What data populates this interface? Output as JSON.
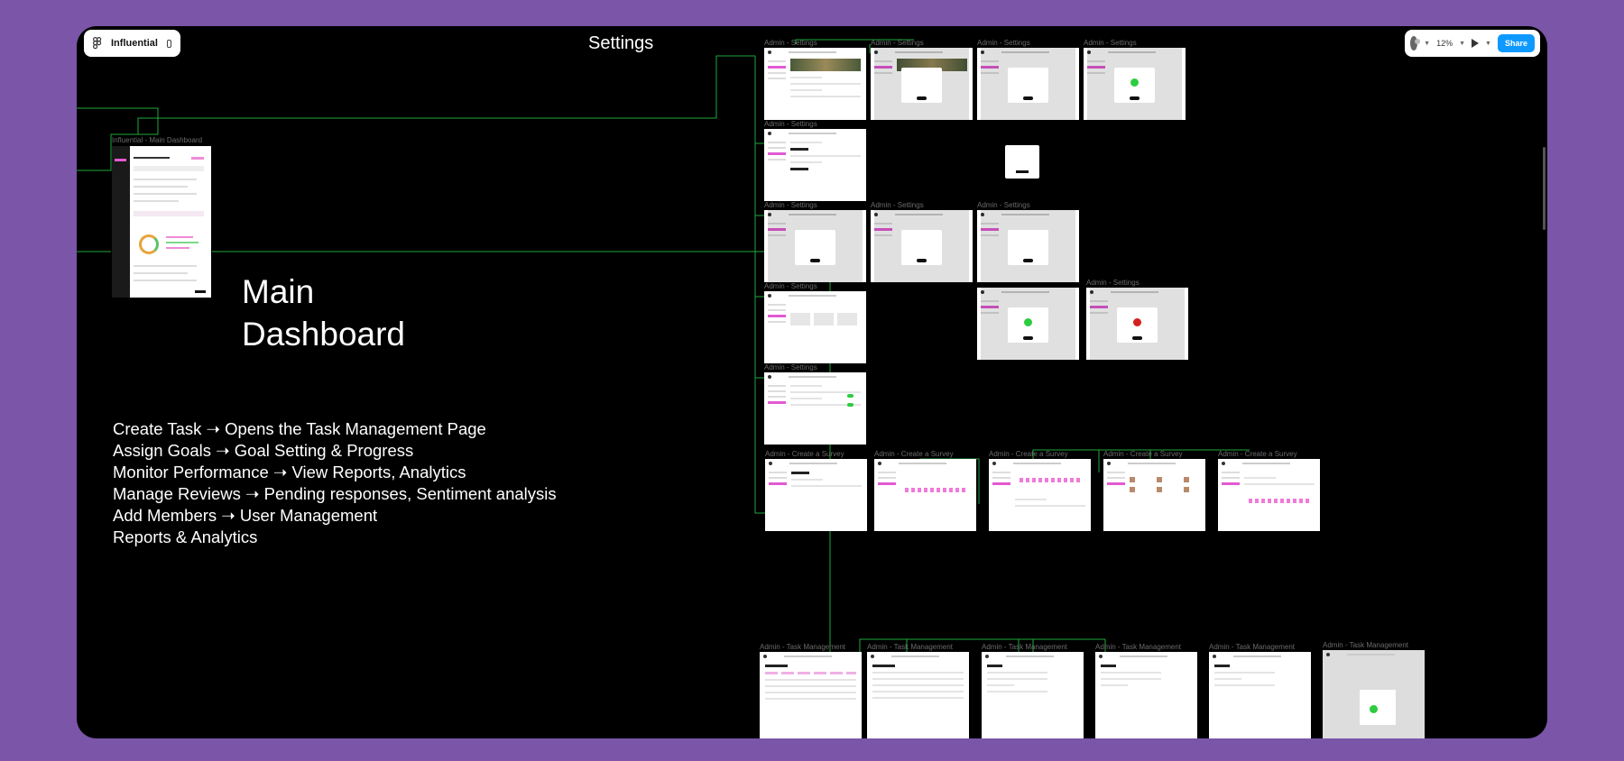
{
  "toolbar": {
    "file_name": "Influential",
    "zoom": "12%",
    "share_label": "Share"
  },
  "page_title": "Settings",
  "main_frame": {
    "label": "Influential - Main Dashboard",
    "heading_line1": "Main",
    "heading_line2": "Dashboard"
  },
  "notes": [
    "Create Task ➝ Opens the Task Management Page",
    "Assign Goals ➝ Goal Setting & Progress",
    "Monitor Performance ➝ View Reports, Analytics",
    "Manage Reviews ➝ Pending responses, Sentiment analysis",
    "Add Members ➝ User Management",
    "Reports & Analytics"
  ],
  "frame_labels": {
    "settings": "Admin - Settings",
    "survey": "Admin - Create a Survey",
    "task": "Admin - Task Management"
  },
  "colors": {
    "background": "#7a55a8",
    "canvas": "#000000",
    "connector": "#1fa83a",
    "accent_pink": "#e25ad2",
    "share_blue": "#0d99ff"
  },
  "icons": {
    "menu": "figma-logo-icon",
    "panel": "sidebar-toggle-icon",
    "present": "play-icon"
  }
}
